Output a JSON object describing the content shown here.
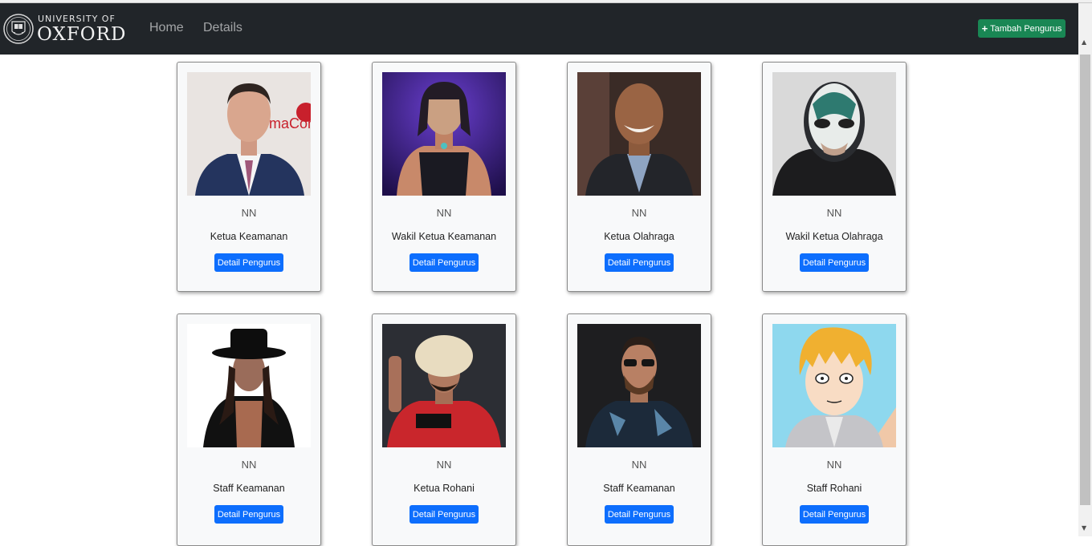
{
  "navbar": {
    "logo": {
      "line1": "UNIVERSITY OF",
      "line2": "OXFORD"
    },
    "links": [
      "Home",
      "Details"
    ],
    "add_button": {
      "icon": "plus-icon",
      "label": "Tambah Pengurus"
    }
  },
  "cards": [
    {
      "name": "NN",
      "role": "Ketua Keamanan",
      "button": "Detail Pengurus"
    },
    {
      "name": "NN",
      "role": "Wakil Ketua Keamanan",
      "button": "Detail Pengurus"
    },
    {
      "name": "NN",
      "role": "Ketua Olahraga",
      "button": "Detail Pengurus"
    },
    {
      "name": "NN",
      "role": "Wakil Ketua Olahraga",
      "button": "Detail Pengurus"
    },
    {
      "name": "NN",
      "role": "Staff Keamanan",
      "button": "Detail Pengurus"
    },
    {
      "name": "NN",
      "role": "Ketua Rohani",
      "button": "Detail Pengurus"
    },
    {
      "name": "NN",
      "role": "Staff Keamanan",
      "button": "Detail Pengurus"
    },
    {
      "name": "NN",
      "role": "Staff Rohani",
      "button": "Detail Pengurus"
    }
  ],
  "colors": {
    "navbar": "#212529",
    "add_button": "#198754",
    "detail_button": "#0d6efd",
    "card_bg": "#f8f9fa"
  }
}
